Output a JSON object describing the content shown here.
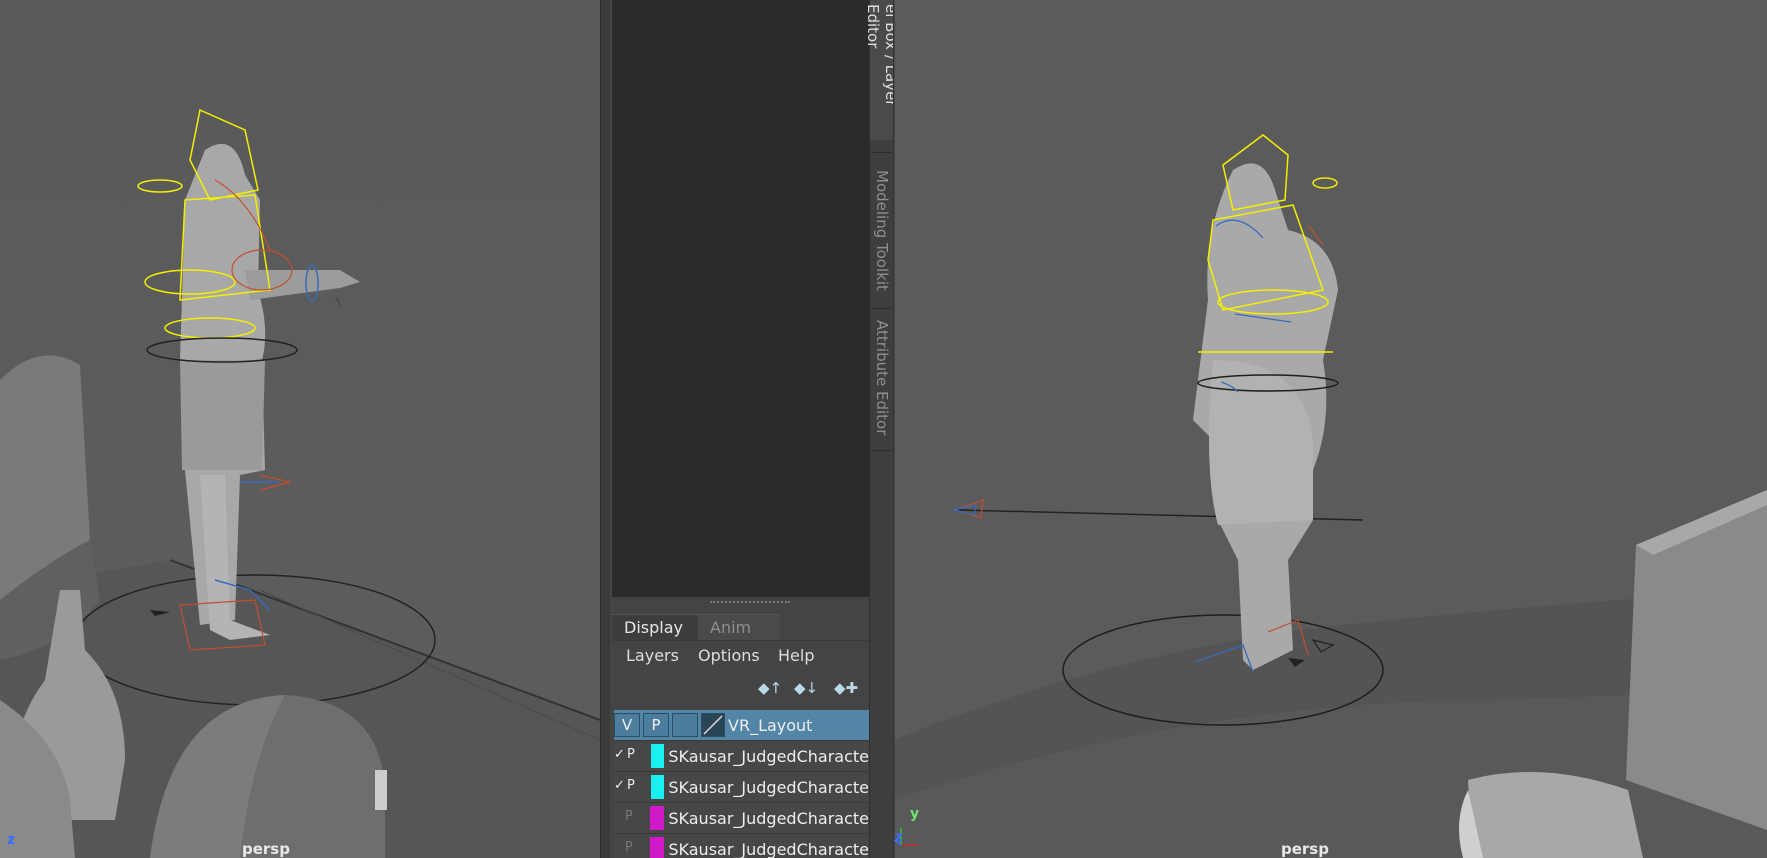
{
  "viewports": {
    "left": {
      "label": "persp",
      "axis_label": "z"
    },
    "right": {
      "label": "persp",
      "axis_label_y": "y",
      "axis_label_z": "z"
    }
  },
  "layer_editor": {
    "tabs": [
      {
        "label": "Display",
        "active": true
      },
      {
        "label": "Anim",
        "active": false
      }
    ],
    "menu": [
      "Layers",
      "Options",
      "Help"
    ],
    "toolbar_icons": [
      "move-layer-up-icon",
      "move-layer-down-icon",
      "create-layer-icon"
    ],
    "layers": [
      {
        "visible": "V",
        "playback": "P",
        "color": "",
        "name": "VR_Layout",
        "selected": true
      },
      {
        "visible": "✓",
        "playback": "P",
        "color": "#19f0f0",
        "name": "SKausar_JudgedCharacte",
        "selected": false
      },
      {
        "visible": "✓",
        "playback": "P",
        "color": "#19f0f0",
        "name": "SKausar_JudgedCharacte",
        "selected": false
      },
      {
        "visible": "",
        "playback": "P",
        "color": "#d019c8",
        "name": "SKausar_JudgedCharacte",
        "selected": false
      },
      {
        "visible": "",
        "playback": "P",
        "color": "#d019c8",
        "name": "SKausar_JudgedCharacte",
        "selected": false
      }
    ]
  },
  "side_tabs": [
    "el Box / Layer Editor",
    "Modeling Toolkit",
    "Attribute Editor"
  ],
  "colors": {
    "selection": "#5285a6",
    "cyan_layer": "#19f0f0",
    "magenta_layer": "#d019c8",
    "rig_yellow": "#f2f000"
  }
}
